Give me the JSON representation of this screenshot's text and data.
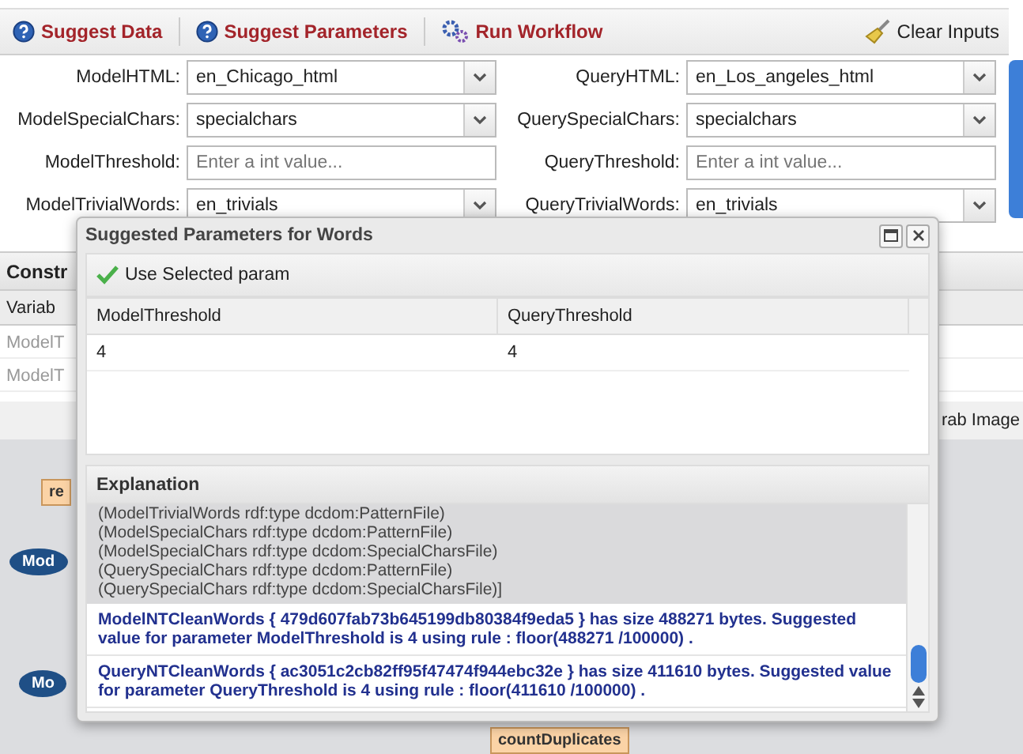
{
  "toolbar": {
    "buttons": [
      {
        "kind": "help",
        "label": "Suggest Data"
      },
      {
        "kind": "help",
        "label": "Suggest Parameters"
      },
      {
        "kind": "gears",
        "label": "Run Workflow"
      }
    ],
    "clear": {
      "label": "Clear Inputs"
    }
  },
  "form": {
    "rows": [
      {
        "left": {
          "label": "ModelHTML:",
          "kind": "select",
          "value": "en_Chicago_html"
        },
        "right": {
          "label": "QueryHTML:",
          "kind": "select",
          "value": "en_Los_angeles_html"
        }
      },
      {
        "left": {
          "label": "ModelSpecialChars:",
          "kind": "select",
          "value": "specialchars"
        },
        "right": {
          "label": "QuerySpecialChars:",
          "kind": "select",
          "value": "specialchars"
        }
      },
      {
        "left": {
          "label": "ModelThreshold:",
          "kind": "text",
          "placeholder": "Enter a int value..."
        },
        "right": {
          "label": "QueryThreshold:",
          "kind": "text",
          "placeholder": "Enter a int value..."
        }
      },
      {
        "left": {
          "label": "ModelTrivialWords:",
          "kind": "select",
          "value": "en_trivials"
        },
        "right": {
          "label": "QueryTrivialWords:",
          "kind": "select",
          "value": "en_trivials"
        }
      }
    ]
  },
  "background": {
    "panel_title": "Constr",
    "column": "Variab",
    "rows": [
      "ModelT",
      "ModelT"
    ],
    "grab_label": "rab Image",
    "nodes": [
      {
        "kind": "box",
        "label": "re"
      },
      {
        "kind": "oval",
        "label": "Mod"
      },
      {
        "kind": "oval",
        "label": "Mo"
      },
      {
        "kind": "box",
        "label": "countDuplicates"
      }
    ]
  },
  "dialog": {
    "title": "Suggested Parameters for Words",
    "action": "Use Selected param",
    "columns": [
      "ModelThreshold",
      "QueryThreshold"
    ],
    "rows": [
      {
        "cells": [
          "4",
          "4"
        ],
        "selected": false
      }
    ],
    "explanation": {
      "title": "Explanation",
      "lines": [
        "(ModelTrivialWords rdf:type dcdom:PatternFile)",
        "(ModelSpecialChars rdf:type dcdom:PatternFile)",
        "(ModelSpecialChars rdf:type dcdom:SpecialCharsFile)",
        "(QuerySpecialChars rdf:type dcdom:PatternFile)",
        "(QuerySpecialChars rdf:type dcdom:SpecialCharsFile)]"
      ],
      "messages": [
        "ModelNTCleanWords { 479d607fab73b645199db80384f9eda5 } has size 488271 bytes. Suggested value for parameter ModelThreshold is 4 using rule : floor(488271 /100000) .",
        "QueryNTCleanWords { ac3051c2cb82ff95f47474f944ebc32e } has size 411610 bytes. Suggested value for parameter QueryThreshold is 4 using rule : floor(411610 /100000) ."
      ]
    }
  }
}
